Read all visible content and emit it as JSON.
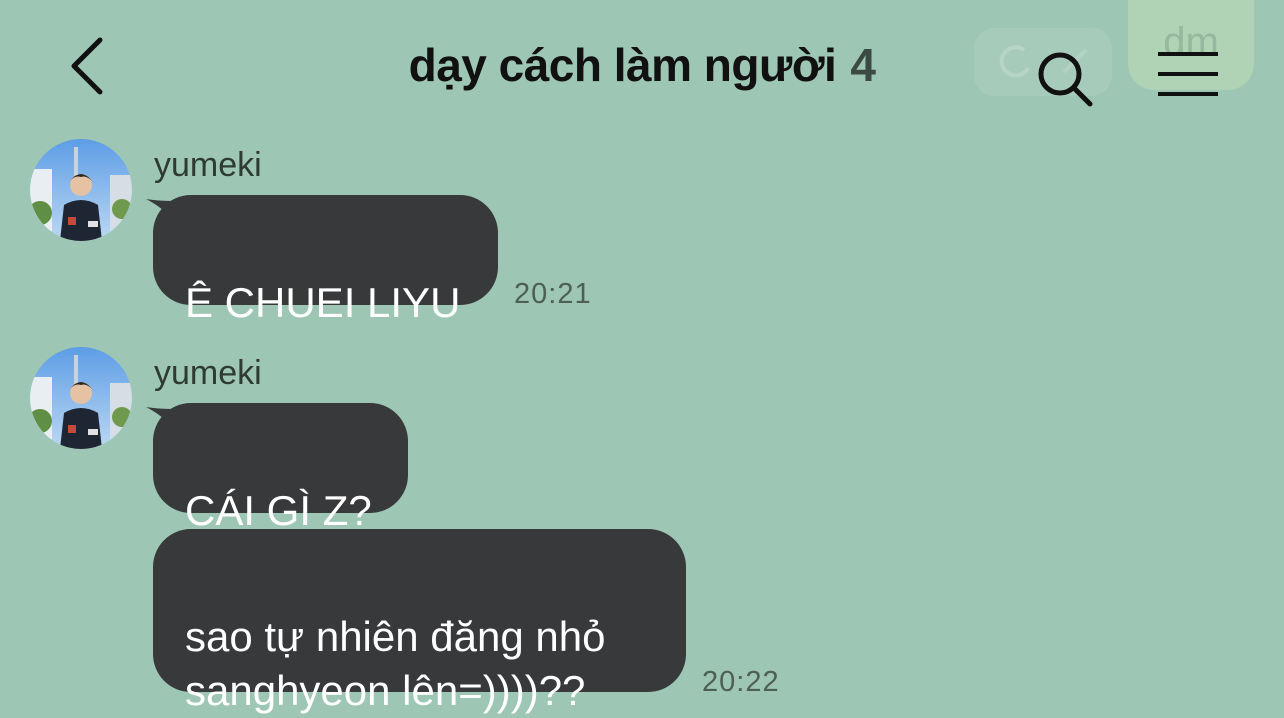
{
  "colors": {
    "background": "#9dc6b4",
    "bubble": "#38393b",
    "bubble_text": "#ffffff",
    "timestamp": "#4e5f57"
  },
  "header": {
    "back_icon": "chevron-left-icon",
    "title": "dạy cách làm người",
    "member_count": "4",
    "search_icon": "search-icon",
    "menu_icon": "hamburger-menu-icon",
    "badge_label": "dm"
  },
  "messages": [
    {
      "sender": "yumeki",
      "avatar_icon": "user-avatar",
      "text": "Ê CHUEI LIYU",
      "time": "20:21"
    },
    {
      "sender": "yumeki",
      "avatar_icon": "user-avatar",
      "text": "CÁI GÌ Z?"
    },
    {
      "text": "sao tự nhiên đăng nhỏ\nsanghyeon lên=))))??",
      "time": "20:22"
    }
  ]
}
